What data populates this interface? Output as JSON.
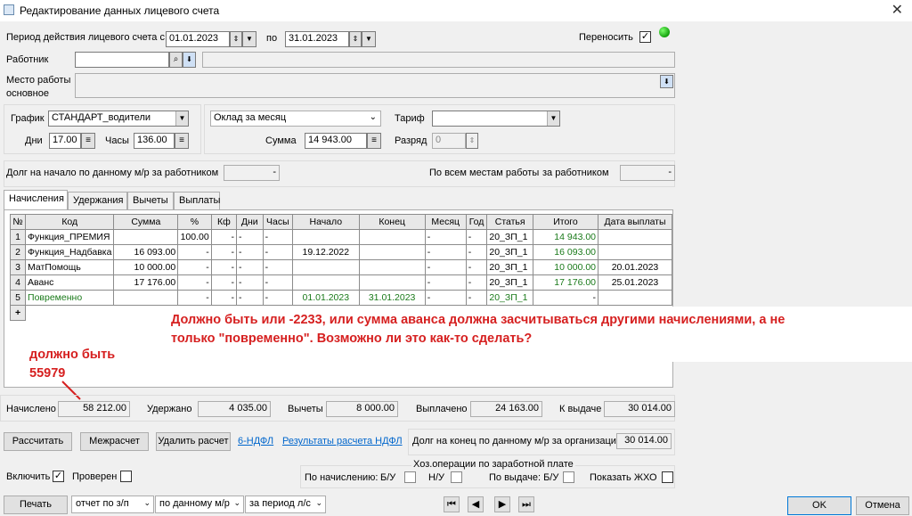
{
  "window": {
    "title": "Редактирование данных лицевого счета",
    "close": "✕"
  },
  "period": {
    "label": "Период действия лицевого счета с",
    "from": "01.01.2023",
    "to_label": "по",
    "to": "31.01.2023",
    "carry_label": "Переносить",
    "carry_checked": true
  },
  "worker": {
    "label": "Работник",
    "value": ""
  },
  "workplace": {
    "label_line1": "Место работы",
    "label_line2": "основное",
    "value": ""
  },
  "schedule": {
    "label": "График",
    "value": "СТАНДАРТ_водители",
    "days_label": "Дни",
    "days": "17.00",
    "hours_label": "Часы",
    "hours": "136.00"
  },
  "salary": {
    "type": "Оклад за месяц",
    "sum_label": "Сумма",
    "sum": "14 943.00",
    "tariff_label": "Тариф",
    "tariff": "",
    "rank_label": "Разряд",
    "rank": "0"
  },
  "debt": {
    "start_label": "Долг на начало по данному м/р за работником",
    "start_value": "-",
    "all_places_label": "По всем местам работы",
    "for_worker_label": "за работником",
    "all_value": "-"
  },
  "tabs": [
    "Начисления",
    "Удержания",
    "Вычеты",
    "Выплаты"
  ],
  "grid": {
    "headers": [
      "№",
      "Код",
      "Сумма",
      "%",
      "Кф",
      "Дни",
      "Часы",
      "Начало",
      "Конец",
      "Месяц",
      "Год",
      "Статья",
      "Итого",
      "Дата выплаты"
    ],
    "rows": [
      [
        "1",
        "Функция_ПРЕМИЯ",
        "",
        "100.00",
        "-",
        "-",
        "-",
        "",
        "",
        "-",
        "-",
        "20_ЗП_1",
        "14 943.00",
        ""
      ],
      [
        "2",
        "Функция_Надбавка",
        "16 093.00",
        "-",
        "-",
        "-",
        "-",
        "19.12.2022",
        "",
        "-",
        "-",
        "20_ЗП_1",
        "16 093.00",
        ""
      ],
      [
        "3",
        "МатПомощь",
        "10 000.00",
        "-",
        "-",
        "-",
        "-",
        "",
        "",
        "-",
        "-",
        "20_ЗП_1",
        "10 000.00",
        "20.01.2023"
      ],
      [
        "4",
        "Аванс",
        "17 176.00",
        "-",
        "-",
        "-",
        "-",
        "",
        "",
        "-",
        "-",
        "20_ЗП_1",
        "17 176.00",
        "25.01.2023"
      ],
      [
        "5",
        "Повременно",
        "",
        "-",
        "-",
        "-",
        "-",
        "01.01.2023",
        "31.01.2023",
        "-",
        "-",
        "20_ЗП_1",
        "-",
        ""
      ]
    ],
    "add_row": "+"
  },
  "annotations": {
    "comment_line1": "Должно быть или -2233, или сумма аванса должна засчитываться другими начислениями, а не",
    "comment_line2": "только \"повременно\". Возможно ли это как-то сделать?",
    "should_be_line1": "должно быть",
    "should_be_line2": "55979"
  },
  "totals": {
    "accrued_label": "Начислено",
    "accrued": "58 212.00",
    "withheld_label": "Удержано",
    "withheld": "4 035.00",
    "deductions_label": "Вычеты",
    "deductions": "8 000.00",
    "paid_label": "Выплачено",
    "paid": "24 163.00",
    "to_pay_label": "К выдаче",
    "to_pay": "30 014.00"
  },
  "actions": {
    "calculate": "Рассчитать",
    "intercalc": "Межрасчет",
    "delete_calc": "Удалить расчет",
    "link_ndfl6": "6-НДФЛ",
    "link_ndfl_results": "Результаты расчета НДФЛ",
    "debt_end_label": "Долг на конец по данному м/р за организацию",
    "debt_end": "30 014.00"
  },
  "flags": {
    "include_label": "Включить",
    "include_checked": true,
    "checked_label": "Проверен",
    "checked_checked": false,
    "ops_group": "Хоз.операции по заработной плате",
    "by_accrual_label": "По начислению:",
    "bu1": "Б/У",
    "nu": "Н/У",
    "by_payment_label": "По выдаче: Б/У",
    "show_label": "Показать ЖХО"
  },
  "footer": {
    "print": "Печать",
    "report_type": "отчет по з/п",
    "scope": "по данному м/р",
    "period": "за период л/с",
    "ok": "OK",
    "cancel": "Отмена"
  },
  "colors": {
    "annotation": "#d62020",
    "link": "#0066cc",
    "green_text": "#1a7a1a"
  }
}
